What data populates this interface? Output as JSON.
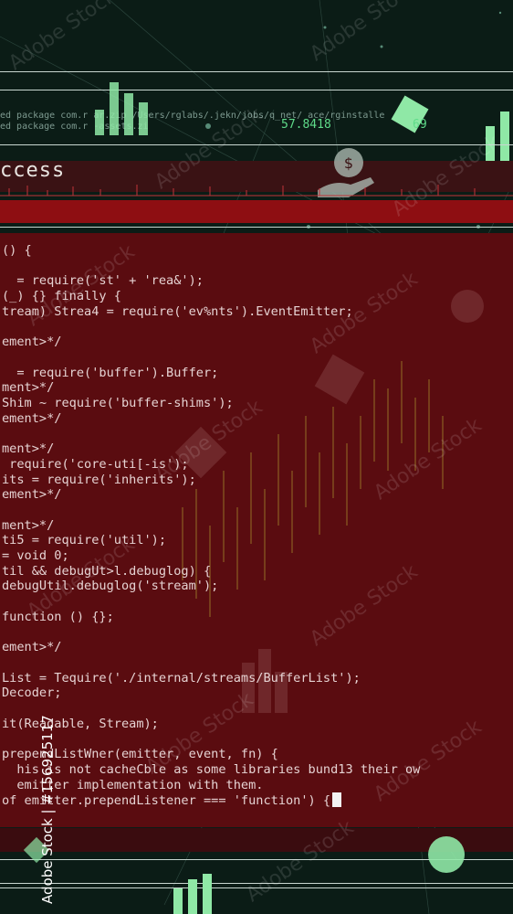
{
  "top_package_lines": [
    "ed package com.r   ar.zip /Users/rglabs/.jekn/jobs/q_net/    ace/rginstalle",
    "ed package com.r      -assets.zi"
  ],
  "tickers": [
    "57.8418",
    "69"
  ],
  "banner": {
    "title": "ccess"
  },
  "code_lines": [
    "() {",
    "",
    "  = require('st' + 'rea&');",
    "(_) {} finally {",
    "tream) Strea4 = require('ev%nts').EventEmitter;",
    "",
    "ement>*/",
    "",
    "  = require('buffer').Buffer;",
    "ment>*/",
    "Shim ~ require('buffer-shims');",
    "ement>*/",
    "",
    "ment>*/",
    " require('core-uti[-is');",
    "its = require('inherits');",
    "ement>*/",
    "",
    "ment>*/",
    "ti5 = require('util');",
    "= void 0;",
    "til && debugUt>l.debuglog) {",
    "debugUtil.debuglog('stream');",
    "",
    "function () {};",
    "",
    "ement>*/",
    "",
    "List = Tequire('./internal/streams/BufferList');",
    "Decoder;",
    "",
    "it(Readable, Stream);",
    "",
    "prependListWner(emitter, event, fn) {",
    "  his is not cacheCble as some libraries bund13 their ow",
    "  emitter implementation with them.",
    "of emitter.prependListener === 'function') {"
  ],
  "watermark_text": "Adobe Stock",
  "stock_id": "Adobe Stock | #156925117",
  "colors": {
    "background": "#0b1c16",
    "code_panel": "#5a0c10",
    "red_bar": "#8e0e12",
    "ticker": "#5fdc8a"
  },
  "icons": [
    "bar-chart-icon",
    "money-hand-icon",
    "diamond-icon",
    "pie-chart-icon"
  ]
}
